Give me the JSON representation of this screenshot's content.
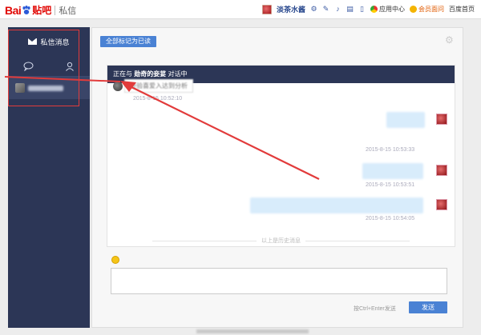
{
  "header": {
    "logo_bai": "Bai",
    "logo_tieba": "贴吧",
    "logo_sub": "私信",
    "username": "淡茶水酱",
    "app_center": "应用中心",
    "vip": "会员面问",
    "baidu_home": "百度首页"
  },
  "sidebar": {
    "title": "私信消息",
    "tabs": [
      {
        "icon": "chat-bubble-icon"
      },
      {
        "icon": "person-icon"
      }
    ]
  },
  "main": {
    "mark_all_read": "全部标记为已读",
    "chat_header_prefix": "正在与",
    "chat_partner": "勋奇的妾荽",
    "chat_header_suffix": "对话中",
    "messages": [
      {
        "side": "left",
        "text": "经验喜爱入达到分析",
        "time": "2015-8-15 10:52:10"
      },
      {
        "side": "right",
        "time": "2015-8-15 10:53:33"
      },
      {
        "side": "right",
        "time": "2015-8-15 10:53:51"
      },
      {
        "side": "right",
        "time": "2015-8-15 10:54:05"
      }
    ],
    "history_label": "以上是历史消息",
    "send_hint": "按Ctrl+Enter发送",
    "send_button": "发送"
  },
  "colors": {
    "sidebar_bg": "#2c3656",
    "accent_blue": "#4a82d4",
    "annotation_red": "#e23b3b"
  }
}
